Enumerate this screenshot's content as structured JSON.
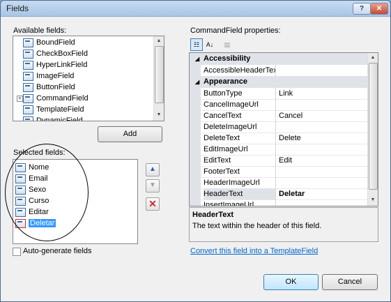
{
  "window": {
    "title": "Fields",
    "help_label": "?",
    "close_label": "✕"
  },
  "available": {
    "label": "Available fields:",
    "items": [
      {
        "label": "BoundField",
        "icon": "bound-field-icon",
        "expandable": false
      },
      {
        "label": "CheckBoxField",
        "icon": "checkbox-field-icon",
        "expandable": false
      },
      {
        "label": "HyperLinkField",
        "icon": "hyperlink-field-icon",
        "expandable": false
      },
      {
        "label": "ImageField",
        "icon": "image-field-icon",
        "expandable": false
      },
      {
        "label": "ButtonField",
        "icon": "button-field-icon",
        "expandable": false
      },
      {
        "label": "CommandField",
        "icon": "command-field-icon",
        "expandable": true
      },
      {
        "label": "TemplateField",
        "icon": "template-field-icon",
        "expandable": false
      },
      {
        "label": "DynamicField",
        "icon": "dynamic-field-icon",
        "expandable": false
      }
    ],
    "add_label": "Add"
  },
  "selected": {
    "label": "Selected fields:",
    "items": [
      {
        "label": "Nome",
        "selected": false
      },
      {
        "label": "Email",
        "selected": false
      },
      {
        "label": "Sexo",
        "selected": false
      },
      {
        "label": "Curso",
        "selected": false
      },
      {
        "label": "Editar",
        "selected": false
      },
      {
        "label": "Deletar",
        "selected": true
      }
    ],
    "move_up_icon": "arrow-up-icon",
    "move_down_icon": "arrow-down-icon",
    "delete_icon": "red-x-delete-icon"
  },
  "autogen": {
    "label": "Auto-generate fields",
    "checked": false
  },
  "properties": {
    "label": "CommandField properties:",
    "toolbar": [
      "categorized-icon",
      "alphabetical-icon",
      "property-pages-icon"
    ],
    "categories": [
      {
        "name": "Accessibility",
        "rows": [
          {
            "name": "AccessibleHeaderText",
            "value": ""
          }
        ]
      },
      {
        "name": "Appearance",
        "rows": [
          {
            "name": "ButtonType",
            "value": "Link"
          },
          {
            "name": "CancelImageUrl",
            "value": ""
          },
          {
            "name": "CancelText",
            "value": "Cancel"
          },
          {
            "name": "DeleteImageUrl",
            "value": ""
          },
          {
            "name": "DeleteText",
            "value": "Delete"
          },
          {
            "name": "EditImageUrl",
            "value": ""
          },
          {
            "name": "EditText",
            "value": "Edit"
          },
          {
            "name": "FooterText",
            "value": ""
          },
          {
            "name": "HeaderImageUrl",
            "value": ""
          },
          {
            "name": "HeaderText",
            "value": "Deletar",
            "highlighted": true
          },
          {
            "name": "InsertImageUrl",
            "value": ""
          }
        ]
      }
    ],
    "description_title": "HeaderText",
    "description_text": "The text within the header of this field.",
    "convert_link": "Convert this field into a TemplateField"
  },
  "buttons": {
    "ok": "OK",
    "cancel": "Cancel"
  },
  "colors": {
    "selection": "#3399ff",
    "link": "#0066cc",
    "delete_x": "#d9262c"
  }
}
